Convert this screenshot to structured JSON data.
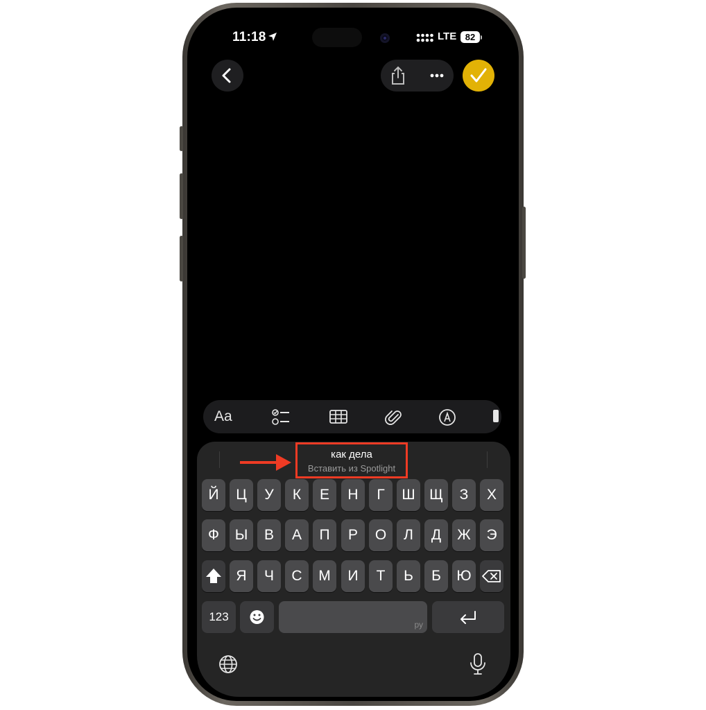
{
  "status_bar": {
    "time": "11:18",
    "network": "LTE",
    "battery": "82"
  },
  "suggestion": {
    "text": "как дела",
    "subtitle": "Вставить из Spotlight"
  },
  "toolbar": {
    "format_label": "Aa"
  },
  "keyboard": {
    "row1": [
      "Й",
      "Ц",
      "У",
      "К",
      "Е",
      "Н",
      "Г",
      "Ш",
      "Щ",
      "З",
      "Х"
    ],
    "row2": [
      "Ф",
      "Ы",
      "В",
      "А",
      "П",
      "Р",
      "О",
      "Л",
      "Д",
      "Ж",
      "Э"
    ],
    "row3": [
      "Я",
      "Ч",
      "С",
      "М",
      "И",
      "Т",
      "Ь",
      "Б",
      "Ю"
    ],
    "numbers_label": "123",
    "space_hint": "ру"
  },
  "colors": {
    "accent": "#e2b206",
    "highlight": "#ef3b24",
    "key": "#4a4a4c",
    "keyboard_bg": "#252525"
  },
  "icons": [
    "location-arrow-icon",
    "signal-icon",
    "back-chevron-icon",
    "share-icon",
    "more-icon",
    "checkmark-icon",
    "checklist-icon",
    "table-icon",
    "paperclip-icon",
    "markup-pen-icon",
    "shift-icon",
    "delete-icon",
    "emoji-icon",
    "return-icon",
    "globe-icon",
    "microphone-icon"
  ]
}
